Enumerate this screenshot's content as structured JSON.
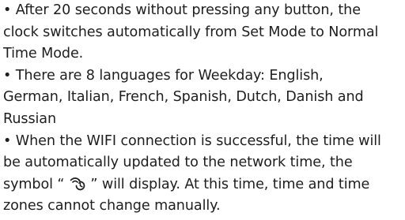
{
  "bullet": "•",
  "paragraphs": [
    {
      "lines": [
        "After 20 seconds without pressing any button, the",
        "clock switches automatically from Set Mode to Normal",
        "Time Mode."
      ]
    },
    {
      "lines": [
        "There are 8 languages for Weekday: English,",
        "German, Italian, French, Spanish, Dutch, Danish and",
        "Russian"
      ]
    },
    {
      "lines": [
        "When the WIFI connection is successful, the time will",
        "be automatically updated to the network time, the"
      ],
      "symbol_line_before": "symbol “ ",
      "symbol_icon": "wifi-sync-icon",
      "symbol_line_after": " ” will display. At this time, time and time",
      "last_line": "zones cannot change manually."
    }
  ]
}
